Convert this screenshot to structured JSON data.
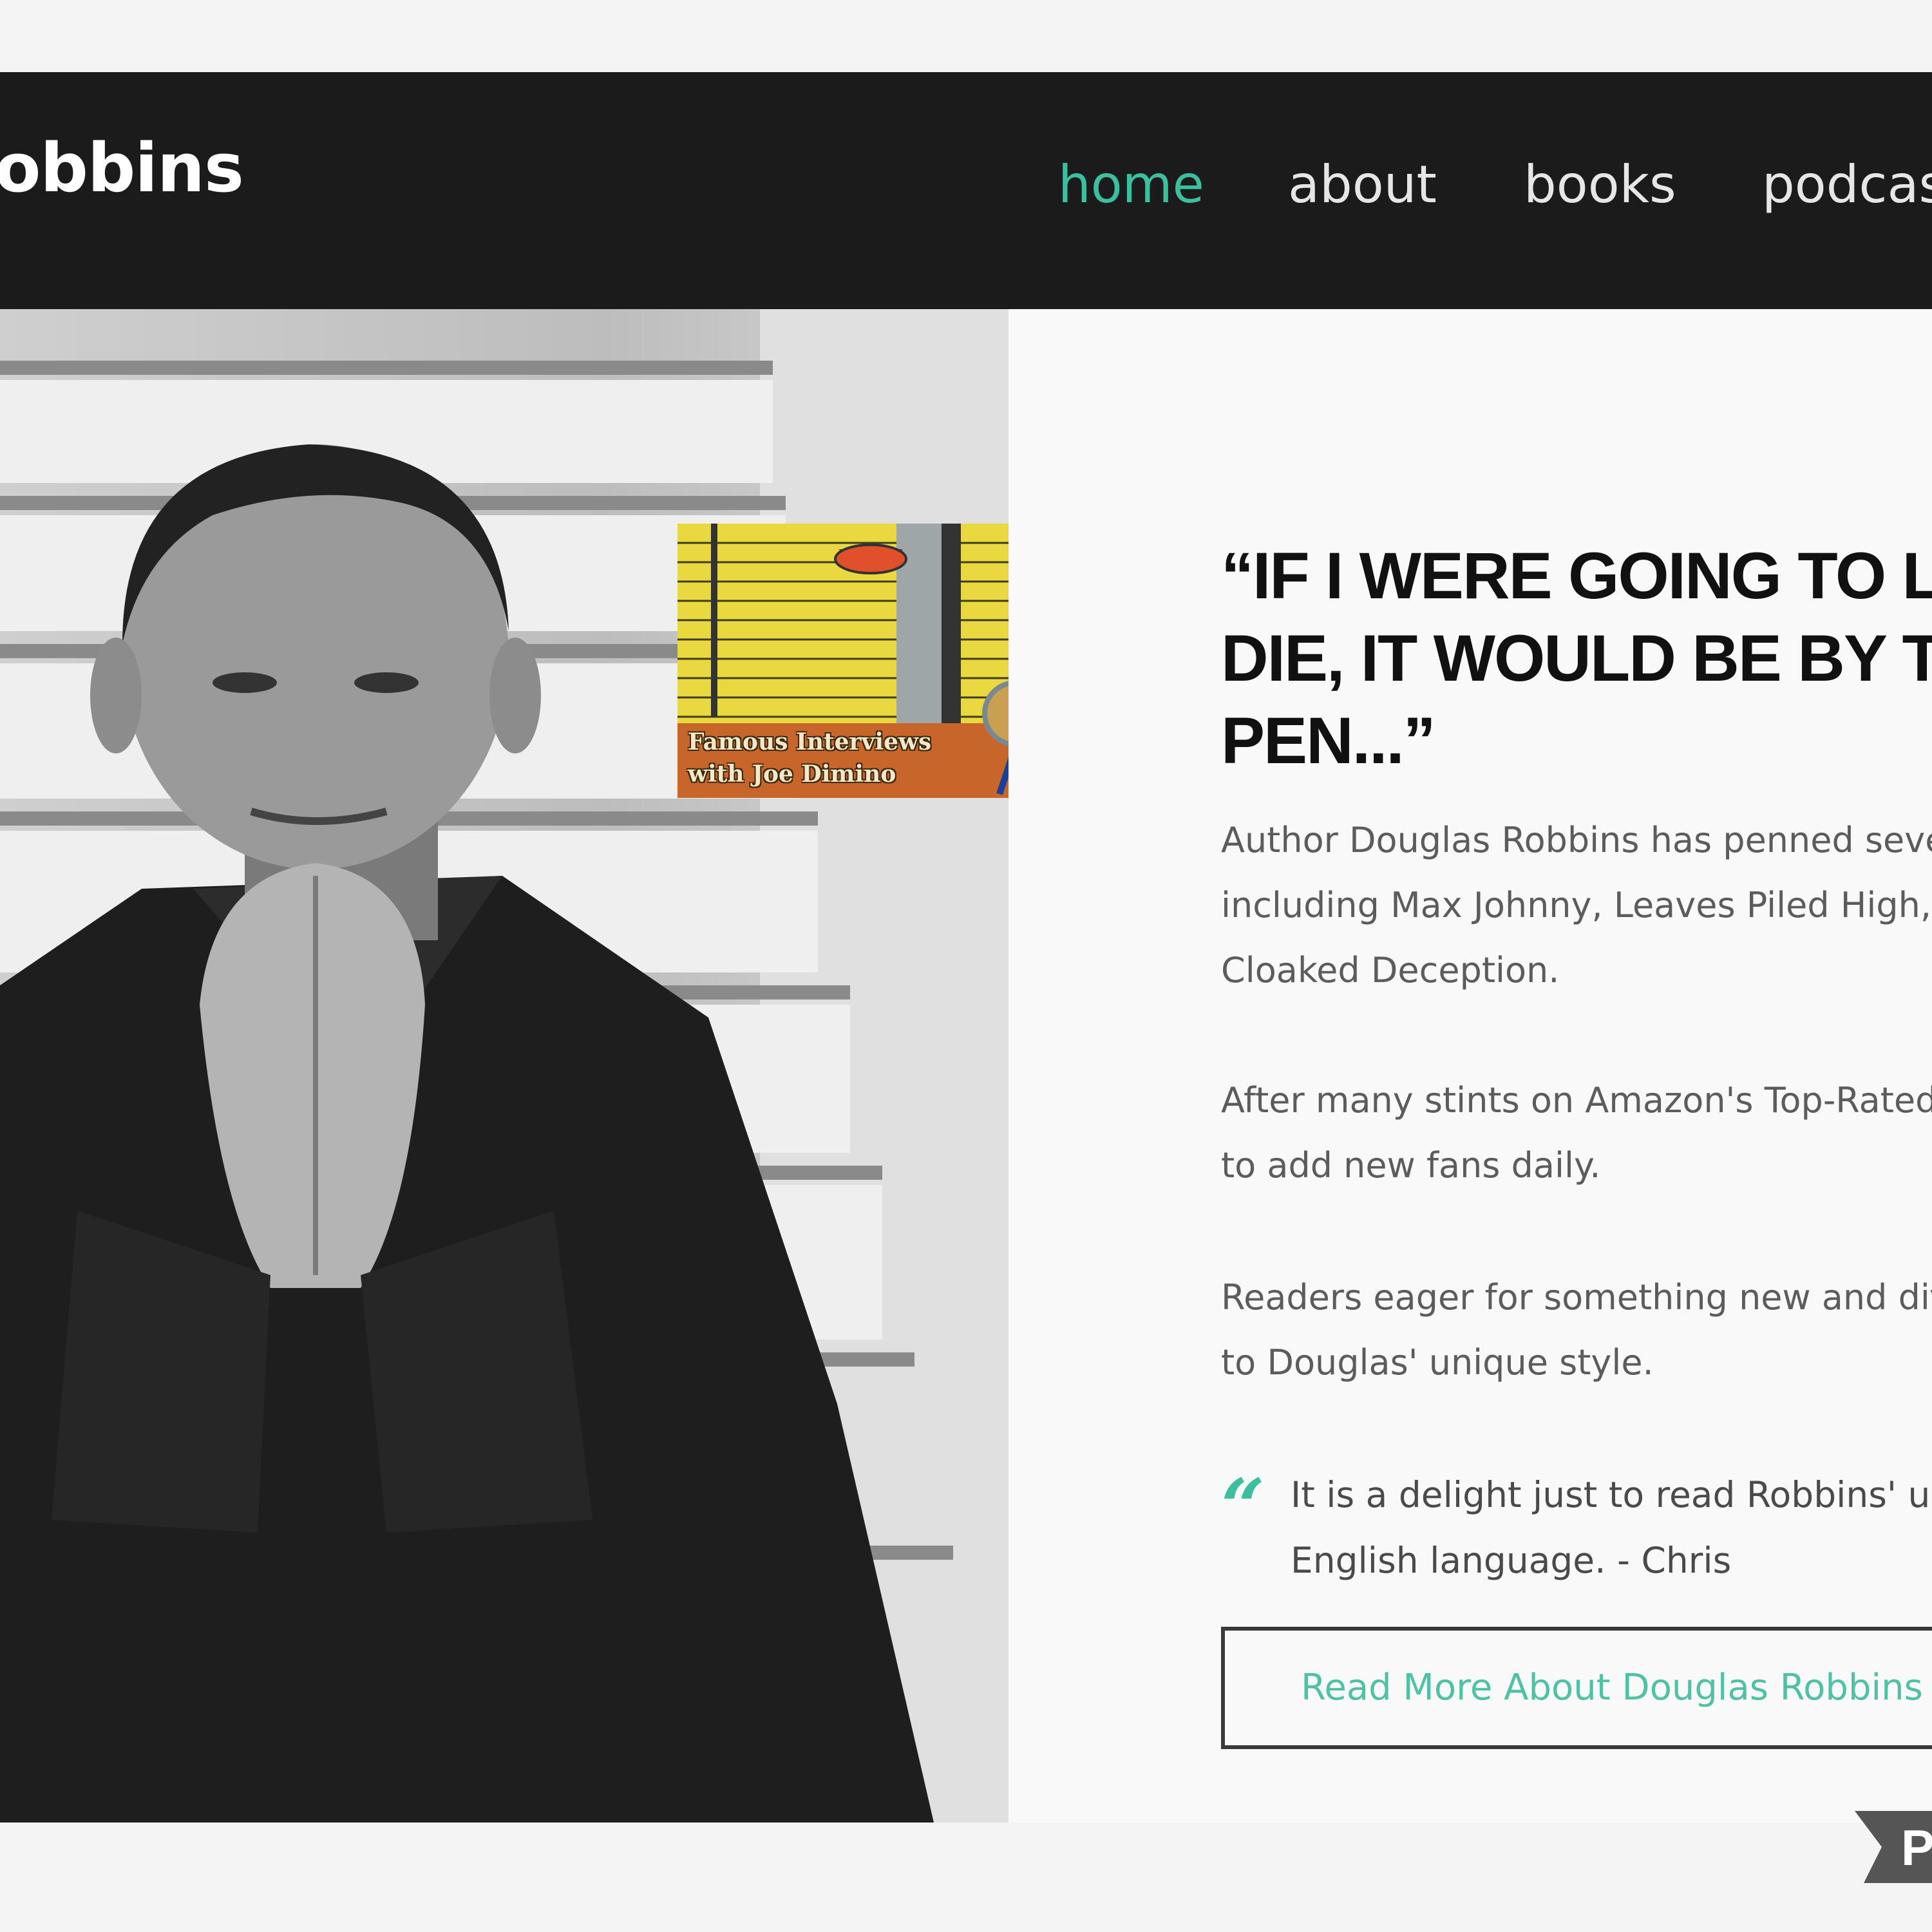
{
  "header": {
    "brand": "obbins",
    "nav": [
      {
        "label": "home",
        "active": true
      },
      {
        "label": "about",
        "active": false
      },
      {
        "label": "books",
        "active": false
      },
      {
        "label": "podcast",
        "active": false
      }
    ]
  },
  "overlay": {
    "caption_line1": "Famous Interviews",
    "caption_line2": "with Joe Dimino"
  },
  "main": {
    "heading_lines": [
      "“IF I WERE GOING TO L",
      "DIE, IT WOULD BE BY T",
      "PEN...”"
    ],
    "paragraphs": [
      [
        "Author Douglas Robbins has penned seve",
        "including Max Johnny, Leaves Piled High,",
        "Cloaked Deception."
      ],
      [
        "After many stints on Amazon's Top-Rated",
        "to add new fans daily."
      ],
      [
        "Readers eager for something new and dif",
        "to Douglas' unique style."
      ]
    ],
    "quote_mark": "“",
    "quote_lines": [
      "It is a delight just to read Robbins' use",
      "English language. - Chris"
    ],
    "read_more_label": "Read More About Douglas Robbins"
  },
  "corner_badge": "P",
  "colors": {
    "accent": "#3bbf9e",
    "nav_bg": "#1b1b1b",
    "panel_bg": "#f9f9f9"
  }
}
